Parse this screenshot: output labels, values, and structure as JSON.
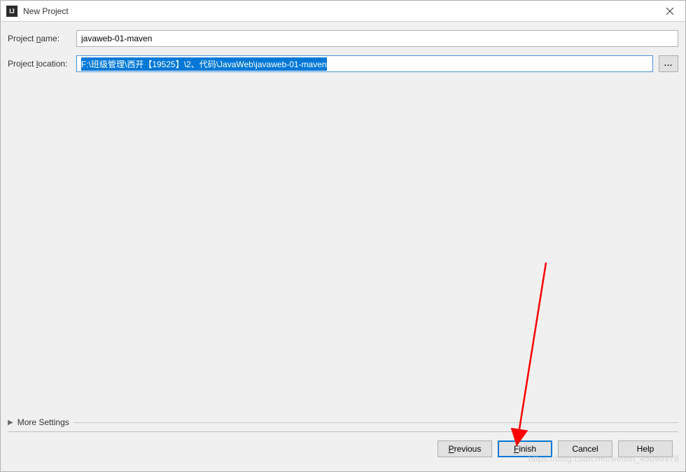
{
  "window": {
    "title": "New Project",
    "icon_label": "IJ"
  },
  "form": {
    "project_name_label": "Project name:",
    "project_name_value": "javaweb-01-maven",
    "project_location_label": "Project location:",
    "project_location_value": "F:\\班级管理\\西开【19525】\\2、代码\\JavaWeb\\javaweb-01-maven",
    "browse_label": "..."
  },
  "more_settings": {
    "label": "More Settings"
  },
  "buttons": {
    "previous": "Previous",
    "finish": "Finish",
    "cancel": "Cancel",
    "help": "Help"
  },
  "watermark": "https://blog.csdn.net/weixin_45098978"
}
